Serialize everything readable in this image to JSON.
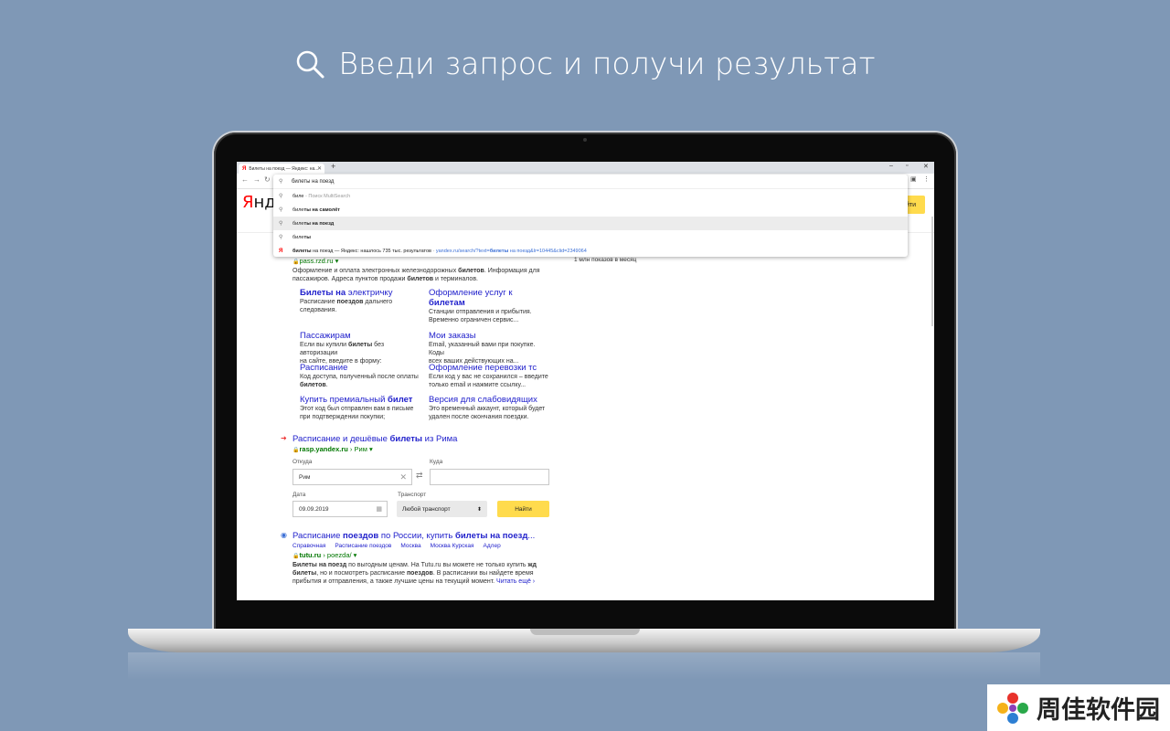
{
  "headline": "Введи запрос и получи результат",
  "browser": {
    "tab_title": "Билеты на поезд — Яндекс: на...",
    "tab_favicon": "Я",
    "omnibox_query": "билеты на поезд",
    "suggestions": [
      {
        "pre": "биле",
        "suffix": " - Поиск MultiSearch"
      },
      {
        "pre": "биле",
        "bold": "ты на самолёт"
      },
      {
        "pre": "биле",
        "bold": "ты на поезд"
      },
      {
        "pre": "биле",
        "bold": "ты"
      }
    ],
    "history_bold": "билеты",
    "history_text": " на поезд — Яндекс: нашлось 735 тыс. результатов",
    "history_sep": " - ",
    "history_url_a": "yandex.ru/search/?text=",
    "history_url_b": "билеты",
    "history_url_c": " на поезд&lr=10445&clid=2349064"
  },
  "yandex": {
    "logo_red": "Я",
    "logo_rest": "нде",
    "search_button": "йти",
    "stats": "1 млн показов в месяц"
  },
  "result1": {
    "url": "pass.rzd.ru",
    "snippet_a": "Оформление и оплата электронных железнодорожных ",
    "snippet_b": "билетов",
    "snippet_c": ". Информация для",
    "snippet_d": "пассажиров. Адреса пунктов продажи ",
    "snippet_e": "билетов",
    "snippet_f": " и терминалов.",
    "sitelinks": [
      {
        "t_b": "Билеты на",
        "t": " электричку",
        "d1": "Расписание ",
        "d1b": "поездов",
        "d1c": " дальнего",
        "d2": "следования."
      },
      {
        "t": "Оформление услуг к ",
        "t2b": "билетам",
        "d1": "Станции отправления и прибытия.",
        "d2": "Временно ограничен сервис..."
      },
      {
        "t": "Пассажирам",
        "d1": "Если вы купили ",
        "d1b": "билеты",
        "d1c": " без авторизации",
        "d2": "на сайте, введите в форму:"
      },
      {
        "t": "Мои заказы",
        "d1": "Email, указанный вами при покупке. Коды",
        "d2": "всех ваших действующих на..."
      },
      {
        "t": "Расписание",
        "d1": "Код доступа, полученный после оплаты",
        "d2b": "билетов",
        "d2": "."
      },
      {
        "t": "Оформление перевозки тс",
        "d1": "Если код у вас не сохранился – введите",
        "d2": "только email и нажмите ссылку..."
      },
      {
        "t": "Купить премиальный ",
        "tb": "билет",
        "d1": "Этот код был отправлен вам в письме",
        "d2": "при подтверждении покупки;"
      },
      {
        "t": "Версия для слабовидящих",
        "d1": "Это временный аккаунт, который будет",
        "d2": "удален после окончания поездки."
      }
    ]
  },
  "result2": {
    "title_a": "Расписание и дешёвые ",
    "title_b": "билеты",
    "title_c": " из Рима",
    "url": "rasp.yandex.ru",
    "url_path": " › Рим ▾",
    "from_label": "Откуда",
    "to_label": "Куда",
    "from_value": "Рим",
    "date_label": "Дата",
    "date_value": "09.09.2019",
    "transport_label": "Транспорт",
    "transport_value": "Любой транспорт",
    "find_button": "Найти"
  },
  "result3": {
    "title_a": "Расписание ",
    "title_b": "поездов",
    "title_c": " по России, купить ",
    "title_d": "билеты на поезд",
    "title_e": "...",
    "crumbs": [
      "Справочная",
      "Расписание поездов",
      "Москва",
      "Москва Курская",
      "Адлер"
    ],
    "url": "tutu.ru",
    "url_path": " › poezda/ ▾",
    "s1b": "Билеты на поезд",
    "s1": " по выгодным ценам. На Tutu.ru вы можете не только купить ",
    "s1c": "жд",
    "s2b": "билеты",
    "s2": ", но и посмотреть расписание ",
    "s2c": "поездов",
    "s2d": ". В расписании вы найдете время",
    "s3": "прибытия и отправления, а также лучшие цены на текущий момент.",
    "more": " Читать ещё ›"
  },
  "watermark": "周佳软件园",
  "colors": {
    "background": "#7f98b6",
    "yandex_yellow": "#ffdb4d",
    "link": "#2222cc",
    "url_green": "#007700"
  }
}
